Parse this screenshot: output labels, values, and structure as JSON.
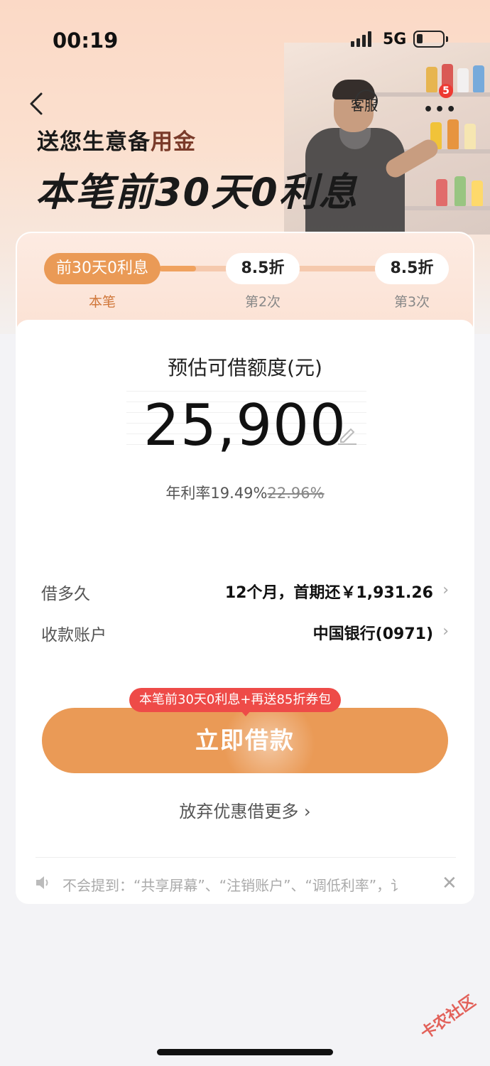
{
  "status_bar": {
    "time": "00:19",
    "network": "5G"
  },
  "nav": {
    "service_label": "客服",
    "more_badge_count": "5"
  },
  "promo": {
    "subtitle_prefix": "送您生意备",
    "subtitle_highlight": "用金",
    "title": "本笔前30天0利息"
  },
  "steps": [
    {
      "tag": "前30天0利息",
      "label": "本笔",
      "active": true
    },
    {
      "tag": "8.5折",
      "label": "第2次",
      "active": false
    },
    {
      "tag": "8.5折",
      "label": "第3次",
      "active": false
    }
  ],
  "loan": {
    "amount_caption": "预估可借额度(元)",
    "amount": "25,900",
    "rate_prefix": "年利率19.49%",
    "rate_original": "22.96%"
  },
  "rows": [
    {
      "label": "借多久",
      "value": "12个月，首期还￥1,931.26"
    },
    {
      "label": "收款账户",
      "value": "中国银行(0971)"
    }
  ],
  "cta": {
    "tip": "本笔前30天0利息+再送85折券包",
    "button": "立即借款",
    "giveup": "放弃优惠借更多 ›"
  },
  "notice": {
    "text": "不会提到：“共享屏幕”、“注销账户”、“调低利率”，讠"
  },
  "watermark": "卡农社区",
  "colors": {
    "accent": "#ea9a56",
    "tip_red": "#ee4b48",
    "hero_bg": "#fbd9c6"
  }
}
